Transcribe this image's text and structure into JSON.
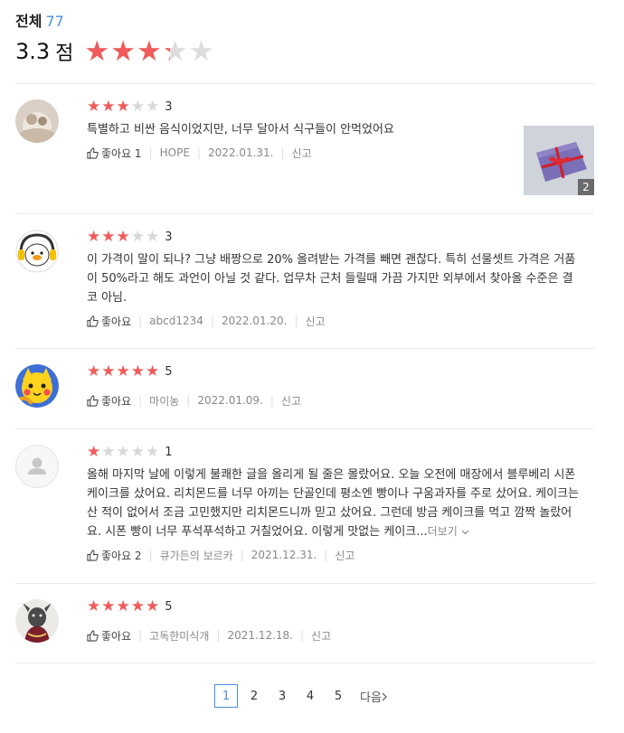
{
  "summary": {
    "title": "전체",
    "count": "77",
    "score": "3.3",
    "unit": "점",
    "rating_value": 3.3,
    "star_color": "#f05a5a"
  },
  "reviews": [
    {
      "rating": 3,
      "score_label": "3",
      "text": "특별하고 비싼 음식이었지만, 너무 달아서 식구들이 안먹었어요",
      "like_label": "좋아요 1",
      "author": "HOPE",
      "date": "2022.01.31.",
      "report": "신고",
      "photo_count": "2",
      "avatar": "photo-avatar-cat"
    },
    {
      "rating": 3,
      "score_label": "3",
      "text": "이 가격이 말이 되나? 그냥 배짱으로 20% 올려받는 가격를 빼면 괜찮다. 특히 선물셋트 가격은 거품이 50%라고 해도 과언이 아닐 것 같다. 업무차 근처 들릴때 가끔 가지만 외부에서 찾아올 수준은 결코 아님.",
      "like_label": "좋아요",
      "author": "abcd1234",
      "date": "2022.01.20.",
      "report": "신고",
      "avatar": "penguin-avatar"
    },
    {
      "rating": 5,
      "score_label": "5",
      "text": "",
      "like_label": "좋아요",
      "author": "마이농",
      "date": "2022.01.09.",
      "report": "신고",
      "avatar": "character-avatar"
    },
    {
      "rating": 1,
      "score_label": "1",
      "text": "올해 마지막 날에 이렇게 불쾌한 글을 올리게 될 줄은 몰랐어요. 오늘 오전에 매장에서 블루베리 시폰케이크를 샀어요. 리치몬드를 너무 아끼는 단골인데 평소엔 빵이나 구움과자를 주로 샀어요. 케이크는 산 적이 없어서 조금 고민했지만 리치몬드니까 믿고 샀어요. 그런데 방금 케이크를 먹고 깜짝 놀랐어요. 시폰 빵이 너무 푸석푸석하고 거칠었어요. 이렇게 맛없는 케이크...",
      "more_label": "더보기",
      "like_label": "좋아요 2",
      "author": "큐가든의 보르카",
      "date": "2021.12.31.",
      "report": "신고",
      "avatar": "default-user-icon"
    },
    {
      "rating": 5,
      "score_label": "5",
      "text": "",
      "like_label": "좋아요",
      "author": "고독한미식개",
      "date": "2021.12.18.",
      "report": "신고",
      "avatar": "dog-avatar"
    }
  ],
  "pagination": {
    "pages": [
      "1",
      "2",
      "3",
      "4",
      "5"
    ],
    "current": "1",
    "next_label": "다음"
  }
}
